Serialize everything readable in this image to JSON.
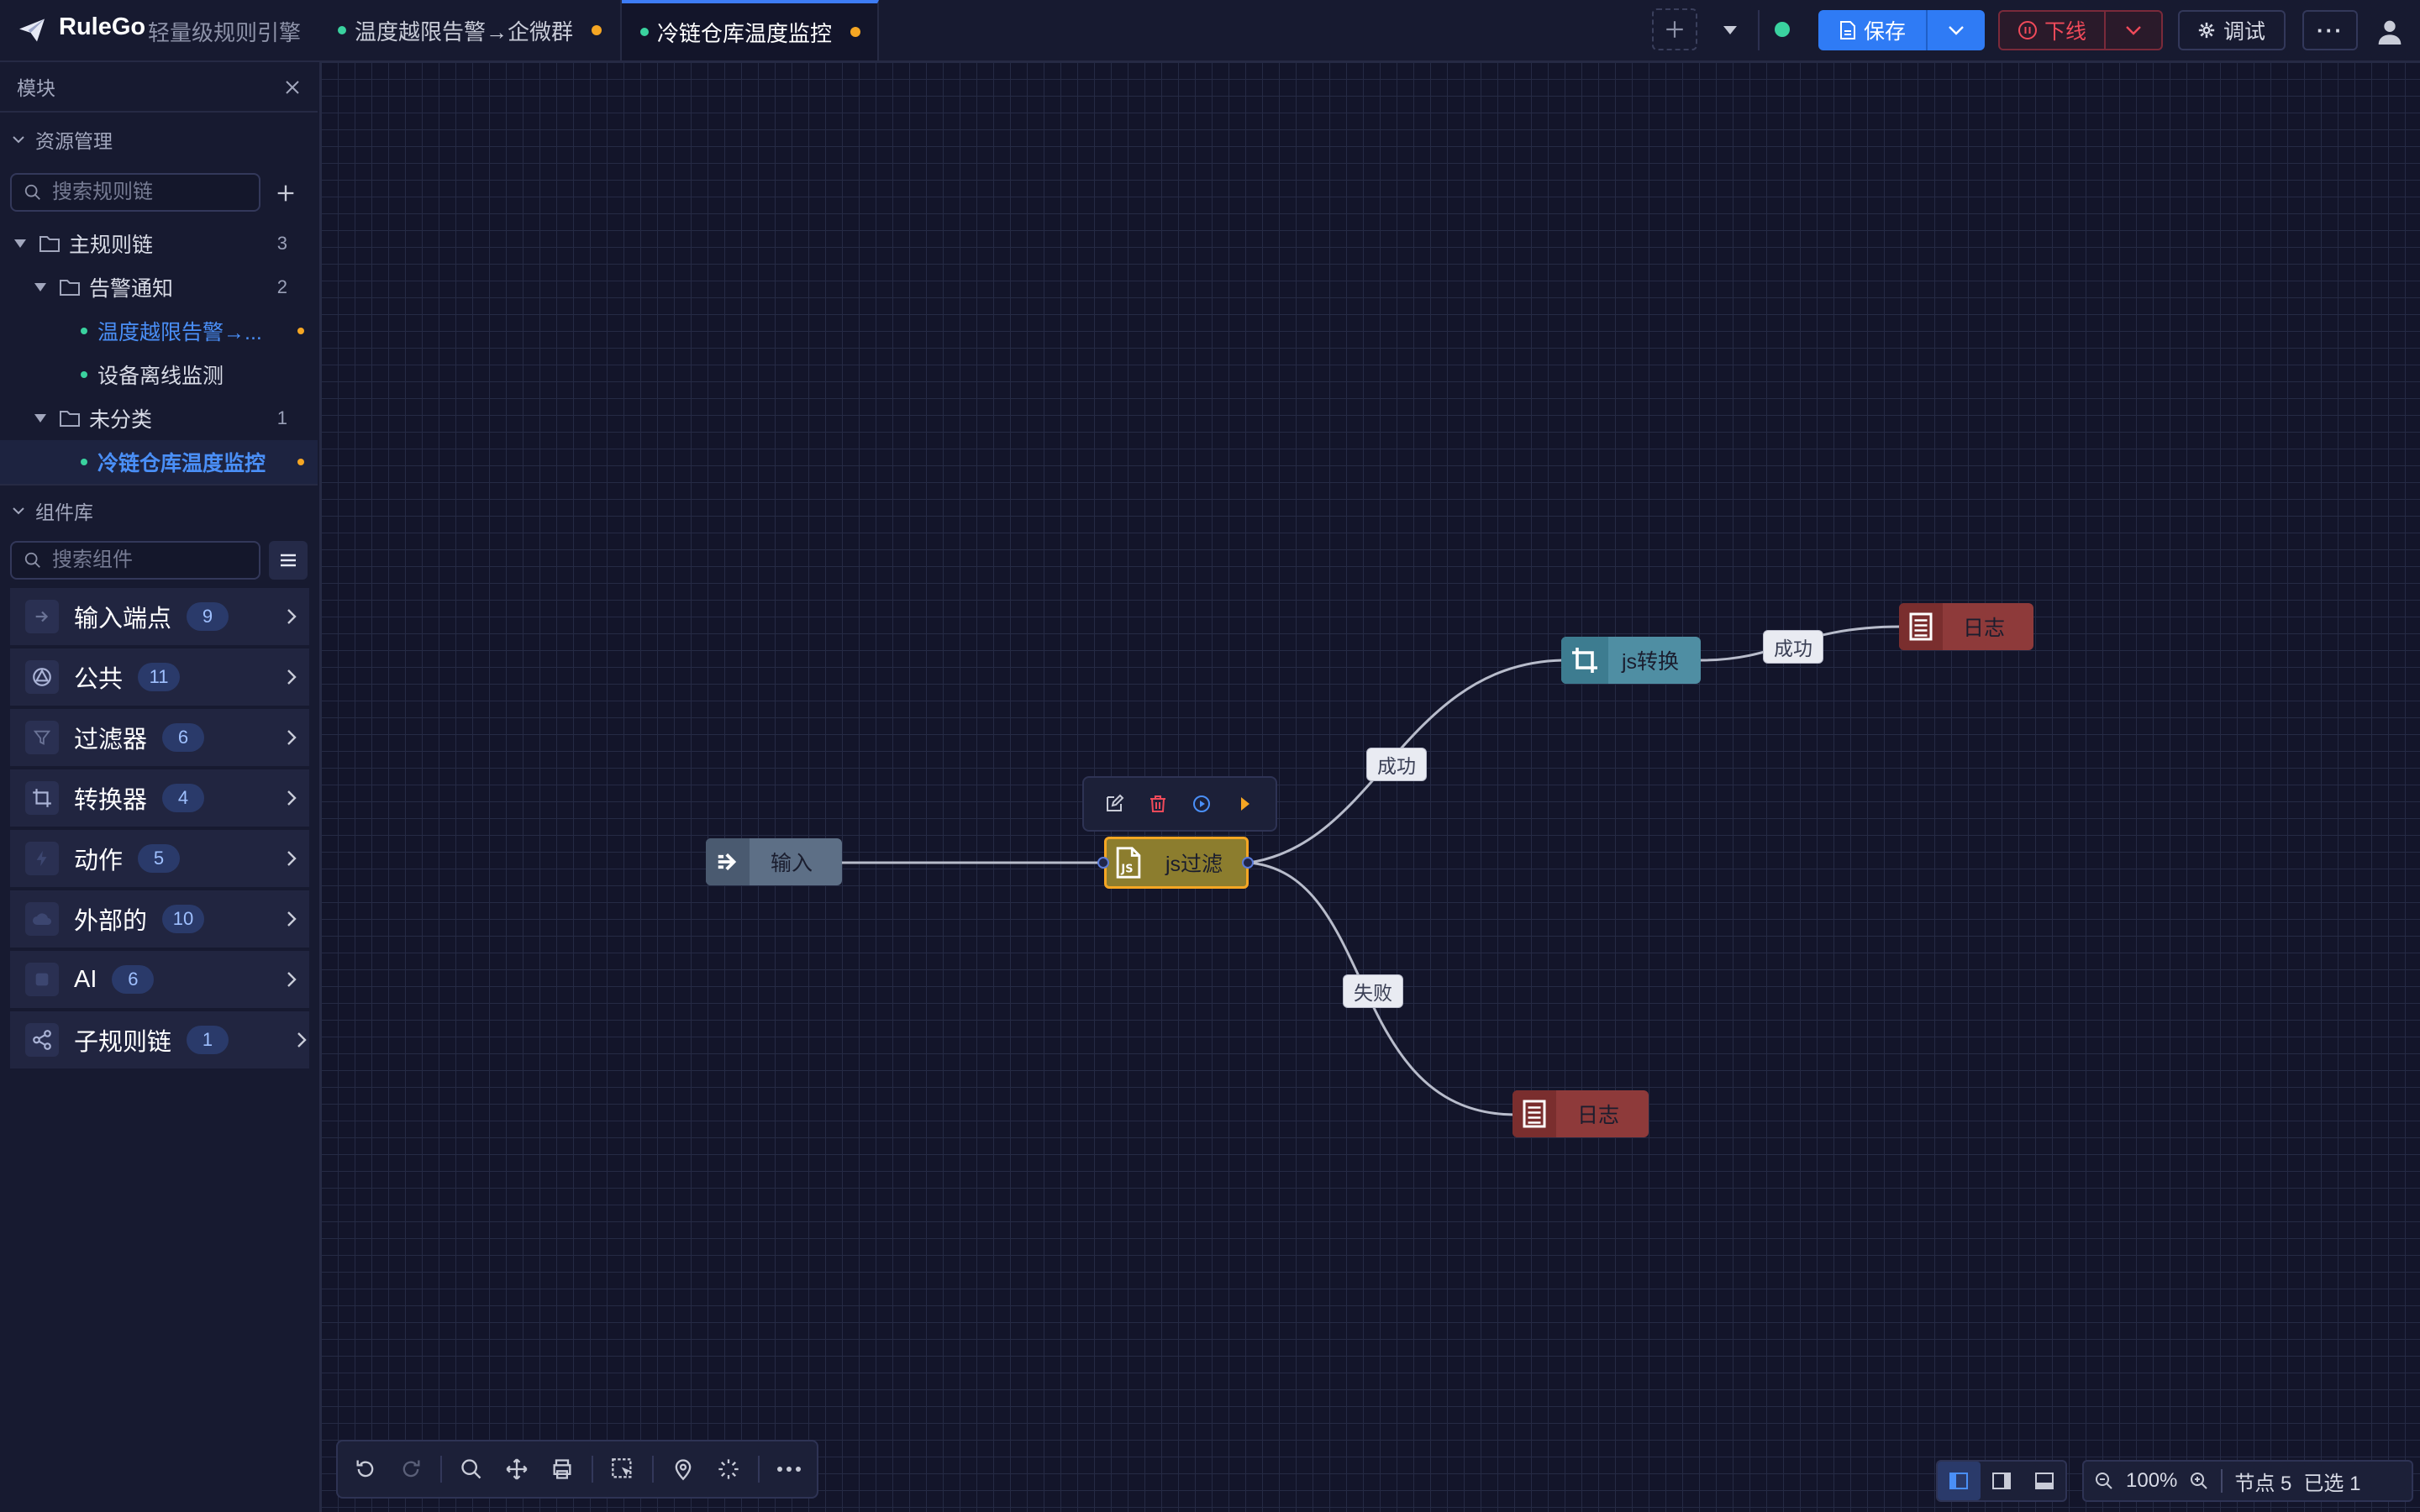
{
  "brand": {
    "name": "RuleGo",
    "subtitle": "轻量级规则引擎"
  },
  "tabs": [
    {
      "label": "温度越限告警→企微群",
      "active": false,
      "modified": true
    },
    {
      "label": "冷链仓库温度监控",
      "active": true,
      "modified": true
    }
  ],
  "toolbar": {
    "save_label": "保存",
    "offline_label": "下线",
    "debug_label": "调试",
    "more_label": "···"
  },
  "sidebar": {
    "title": "模块",
    "resources": {
      "header": "资源管理",
      "search_placeholder": "搜索规则链",
      "tree": [
        {
          "label": "主规则链",
          "count": "3",
          "level": 0,
          "type": "folder"
        },
        {
          "label": "告警通知",
          "count": "2",
          "level": 1,
          "type": "folder"
        },
        {
          "label": "温度越限告警→...",
          "level": 2,
          "type": "chain",
          "modified": true,
          "state": "open"
        },
        {
          "label": "设备离线监测",
          "level": 2,
          "type": "chain"
        },
        {
          "label": "未分类",
          "count": "1",
          "level": 1,
          "type": "folder"
        },
        {
          "label": "冷链仓库温度监控",
          "level": 2,
          "type": "chain",
          "modified": true,
          "state": "active"
        }
      ]
    },
    "library": {
      "header": "组件库",
      "search_placeholder": "搜索组件",
      "items": [
        {
          "name": "输入端点",
          "count": "9",
          "icon": "input-endpoint-icon"
        },
        {
          "name": "公共",
          "count": "11",
          "icon": "common-icon"
        },
        {
          "name": "过滤器",
          "count": "6",
          "icon": "filter-icon"
        },
        {
          "name": "转换器",
          "count": "4",
          "icon": "transform-icon"
        },
        {
          "name": "动作",
          "count": "5",
          "icon": "action-icon"
        },
        {
          "name": "外部的",
          "count": "10",
          "icon": "external-icon"
        },
        {
          "name": "AI",
          "count": "6",
          "icon": "ai-icon"
        },
        {
          "name": "子规则链",
          "count": "1",
          "icon": "sub-chain-icon"
        }
      ]
    }
  },
  "canvas": {
    "nodes": {
      "input": "输入",
      "jsfilter": "js过滤",
      "jstransform": "js转换",
      "log_success": "日志",
      "log_failure": "日志"
    },
    "edges": {
      "filter_to_transform": "成功",
      "transform_to_log": "成功",
      "filter_to_log": "失败"
    }
  },
  "status": {
    "zoom": "100%",
    "nodes": "节点 5",
    "selected": "已选 1"
  },
  "colors": {
    "accent": "#2f7bf5",
    "danger": "#f04a5a",
    "online": "#3ad29f",
    "modified": "#f5a623",
    "node_input": "#5d6f86",
    "node_filter": "#8c7d2e",
    "node_transform": "#4f8ea3",
    "node_log": "#8e3a3a"
  }
}
